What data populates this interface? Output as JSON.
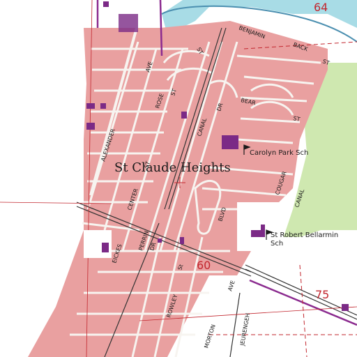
{
  "map": {
    "place_name": "St Claude Heights",
    "grid_numbers": [
      "64",
      "60",
      "75"
    ],
    "streets": {
      "alexander": "ALEXANDER",
      "rose": "ROSE",
      "ave_north": "AVE",
      "st_rose": "ST",
      "canal_dr": "CANAL",
      "dr": "DR",
      "benjamin": "BENJAMIN",
      "st_benjamin": "ST",
      "back": "BACK",
      "st_back": "ST",
      "bear": "BEAR",
      "st_bear": "ST",
      "center": "CENTER",
      "st_center": "ST",
      "cougar": "COUGAR",
      "blvd": "BLVD",
      "canal_east": "CANAL",
      "eckes": "EICKES",
      "perrin": "PERRIN",
      "dr_perrin": "DR",
      "rowley": "ROWLEY",
      "ave_south": "AVE",
      "morton": "MORTON",
      "jeurengeh": "JEURENGEH",
      "st_single": "St"
    },
    "schools": {
      "carolyn_park": "Carolyn Park Sch",
      "st_robert_line1": "St Robert Bellarmin",
      "st_robert_line2": "Sch"
    },
    "colors": {
      "urban_tint": "#e9a0a0",
      "street": "#f7f4f0",
      "water": "#a8dce6",
      "marsh_green": "#cfe8b0",
      "boundary_purple": "#8b2b8f",
      "grid_red": "#c2262e",
      "building": "#7b2a86",
      "contour": "#b27a5a"
    }
  }
}
